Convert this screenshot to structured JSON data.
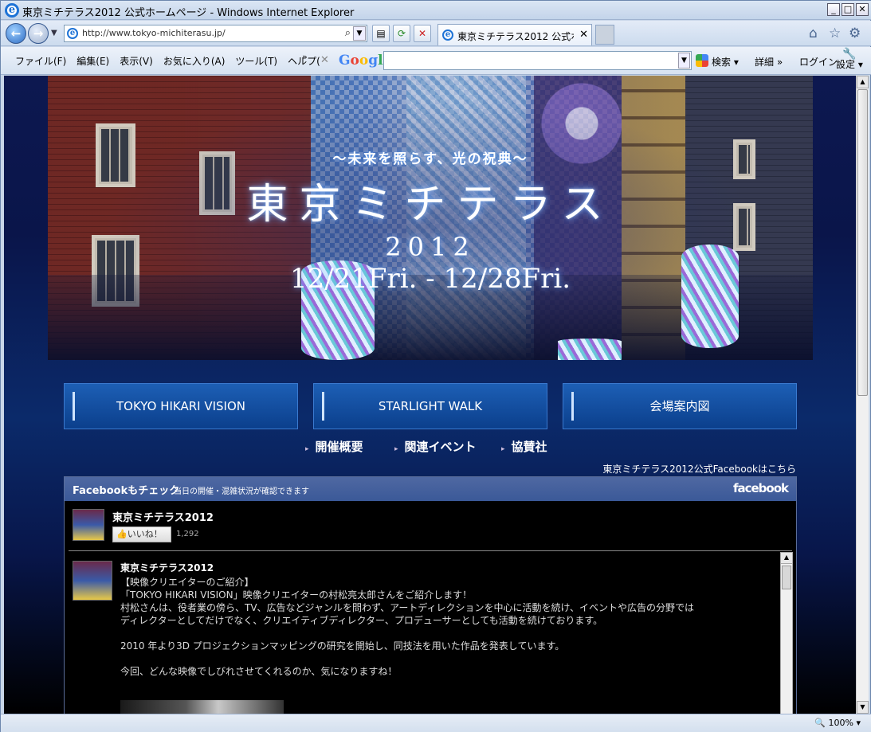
{
  "window": {
    "title": "東京ミチテラス2012 公式ホームページ - Windows Internet Explorer"
  },
  "nav": {
    "url": "http://www.tokyo-michiterasu.jp/",
    "tab_title": "東京ミチテラス2012 公式ホー...",
    "icons": [
      "back-icon",
      "forward-icon",
      "search-icon",
      "refresh-icon",
      "stop-icon",
      "home-icon",
      "favorites-star-icon",
      "gear-icon"
    ]
  },
  "menu": {
    "items": [
      "ファイル(F)",
      "編集(E)",
      "表示(V)",
      "お気に入り(A)",
      "ツール(T)",
      "ヘルプ("
    ],
    "google": "Google",
    "search_btn": "検索",
    "details": "詳細",
    "login": "ログイン",
    "settings": "設定"
  },
  "hero": {
    "subtitle": "〜未来を照らす、光の祝典〜",
    "title": "東京ミチテラス",
    "year": "2012",
    "dates": "12/21Fri. - 12/28Fri."
  },
  "buttons": [
    "TOKYO HIKARI VISION",
    "STARLIGHT WALK",
    "会場案内図"
  ],
  "subnav": [
    "開催概要",
    "関連イベント",
    "協賛社"
  ],
  "fb_link": "東京ミチテラス2012公式Facebookはこちら",
  "facebook": {
    "header": "Facebookもチェック",
    "header_note": "当日の開催・混雑状況が確認できます",
    "logo": "facebook",
    "page_name": "東京ミチテラス2012",
    "like_label": "いいね！",
    "like_count": "1,292",
    "post": {
      "author": "東京ミチテラス2012",
      "lines": [
        "【映像クリエイターのご紹介】",
        "「TOKYO HIKARI VISION」映像クリエイターの村松亮太郎さんをご紹介します！",
        "村松さんは、役者業の傍ら、TV、広告などジャンルを問わず、アートディレクションを中心に活動を続け、イベントや広告の分野では",
        "ディレクターとしてだけでなく、クリエイティブディレクター、プロデューサーとしても活動を続けております。",
        "",
        "2010 年より3D プロジェクションマッピングの研究を開始し、同技法を用いた作品を発表しています。",
        "",
        "今回、どんな映像でしびれさせてくれるのか、気になりますね！"
      ]
    }
  },
  "status": {
    "zoom": "100%"
  }
}
